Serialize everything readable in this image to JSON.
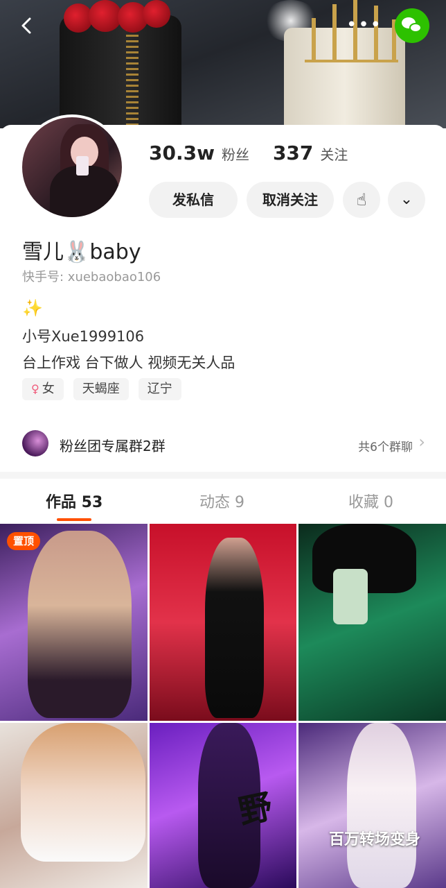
{
  "header": {
    "back_icon": "chevron-left-icon",
    "more_icon": "more-dots-icon",
    "share_icon": "wechat-icon",
    "more_label": "•••"
  },
  "profile": {
    "name": "雪儿🐰baby",
    "kuaishou_id": "快手号: xuebaobao106",
    "sparkle": "✨",
    "bio_line1": "小号Xue1999106",
    "bio_line2": "台上作戏 台下做人 视频无关人品",
    "stats": {
      "followers_value": "30.3w",
      "followers_label": "粉丝",
      "following_value": "337",
      "following_label": "关注"
    },
    "tags": {
      "gender": "女",
      "zodiac": "天蝎座",
      "location": "辽宁"
    }
  },
  "actions": {
    "message_label": "发私信",
    "unfollow_label": "取消关注",
    "hand_glyph": "☝",
    "dropdown_glyph": "⌄"
  },
  "group": {
    "name": "粉丝团专属群2群",
    "count": "共6个群聊",
    "chevron": "›"
  },
  "tabs": {
    "works": "作品 53",
    "moments": "动态 9",
    "favorites": "收藏 0",
    "active": "works"
  },
  "grid": {
    "pinned_badge": "置顶",
    "tile5_text": "野",
    "tile6_caption": "百万转场变身"
  },
  "colors": {
    "accent": "#ff5000",
    "wechat": "#2dc100"
  }
}
